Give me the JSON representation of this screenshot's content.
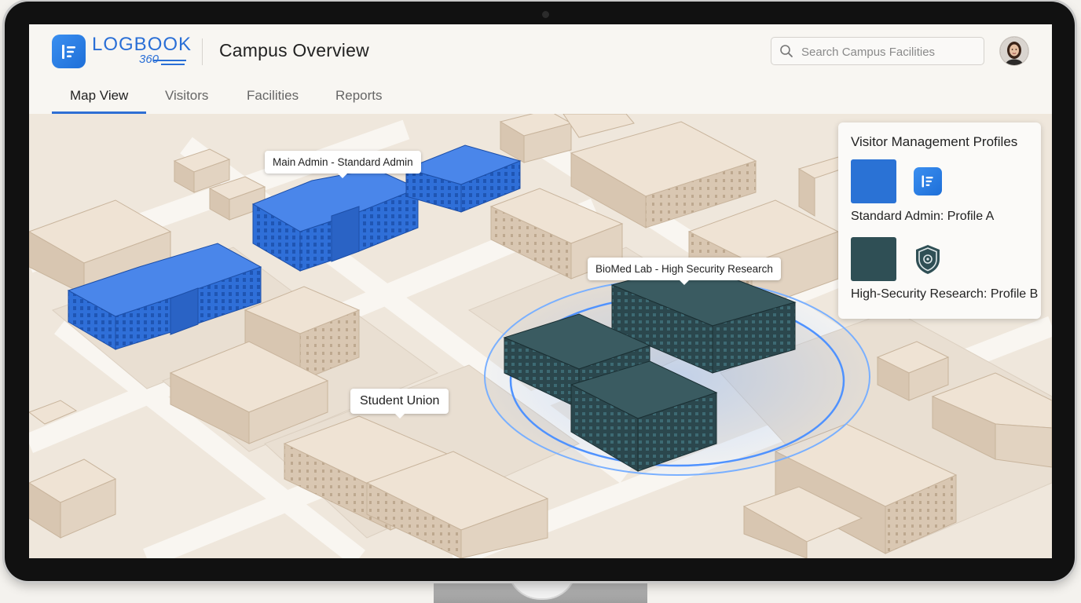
{
  "app": {
    "logo_word": "LOGBOOK",
    "logo_number": "360",
    "page_title": "Campus Overview"
  },
  "search": {
    "placeholder": "Search Campus Facilities"
  },
  "tabs": [
    {
      "label": "Map View",
      "active": true
    },
    {
      "label": "Visitors",
      "active": false
    },
    {
      "label": "Facilities",
      "active": false
    },
    {
      "label": "Reports",
      "active": false
    }
  ],
  "map": {
    "labels": {
      "main_admin": "Main Admin - Standard Admin",
      "biomed": "BioMed Lab - High Security Research",
      "student_union": "Student Union"
    }
  },
  "profiles_panel": {
    "title": "Visitor Management Profiles",
    "items": [
      {
        "label": "Standard Admin: Profile A",
        "color": "#2a72d5",
        "icon": "logbook-icon"
      },
      {
        "label": "High-Security Research: Profile B",
        "color": "#2f4f55",
        "icon": "shield-icon"
      }
    ]
  },
  "colors": {
    "accent": "#2e6fd4",
    "standard_admin_building": "#2f6fd8",
    "high_security_building": "#2f4f55",
    "generic_building": "#e2d3c1"
  }
}
